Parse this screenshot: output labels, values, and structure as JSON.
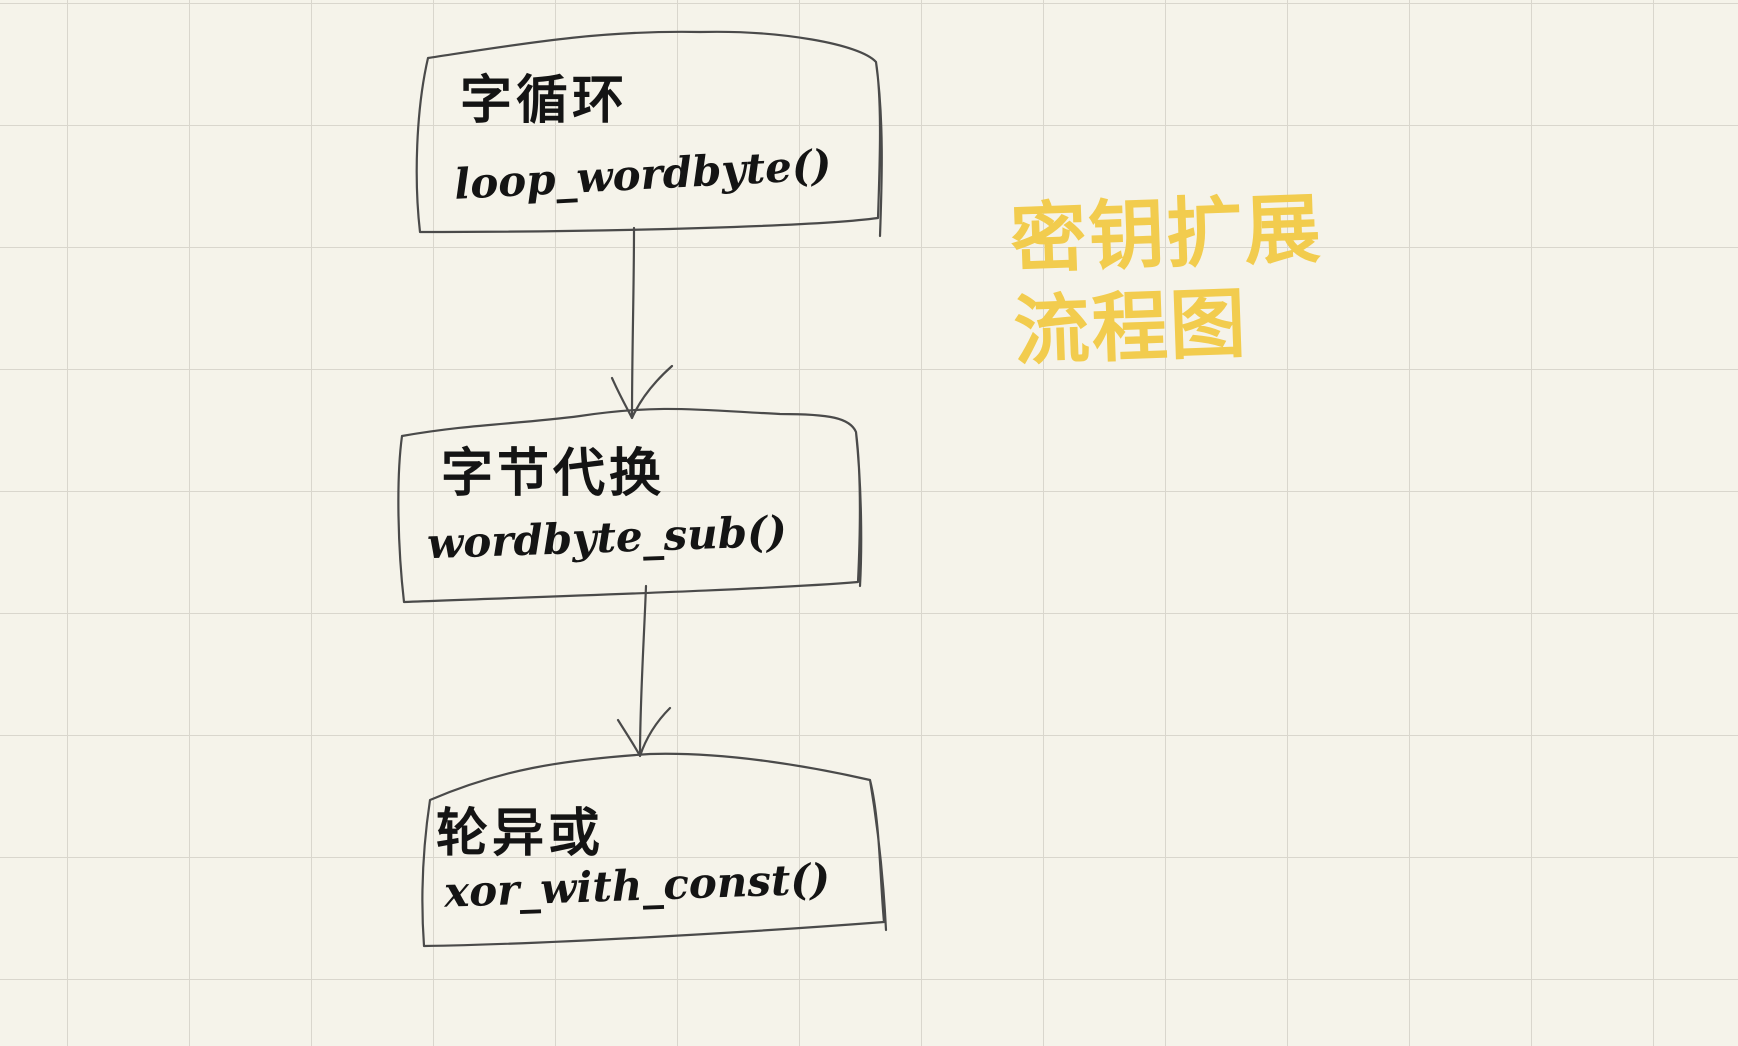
{
  "diagram": {
    "title_lines": [
      "密钥扩展",
      "流程图"
    ],
    "title_color": "#f2cc4e",
    "ink_color": "#141414",
    "grid_color": "#d9d6cd",
    "paper_color": "#f5f3ea",
    "nodes": [
      {
        "label": "字循环",
        "func": "loop_wordbyte()"
      },
      {
        "label": "字节代换",
        "func": "wordbyte_sub()"
      },
      {
        "label": "轮异或",
        "func": "xor_with_const()"
      }
    ],
    "edges": [
      {
        "from": 0,
        "to": 1
      },
      {
        "from": 1,
        "to": 2
      }
    ]
  }
}
